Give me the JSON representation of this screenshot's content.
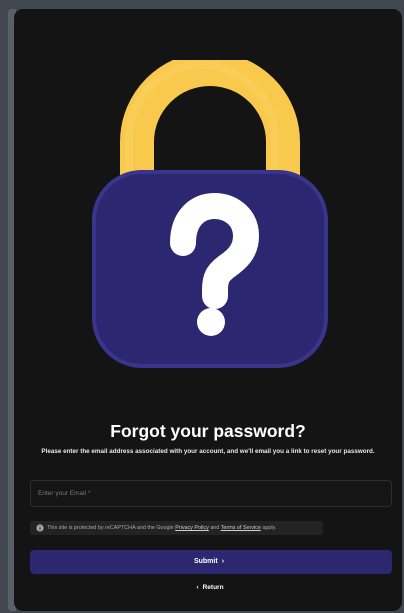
{
  "title": "Forgot your password?",
  "description": "Please enter the email address associated with your account, and we'll email you a link to reset your password.",
  "email": {
    "placeholder": "Enter your Email",
    "required_marker": "*",
    "value": ""
  },
  "recaptcha": {
    "prefix": "This site is protected by reCAPTCHA and the Google",
    "privacy_link": "Privacy Policy",
    "and": "and",
    "terms_link": "Terms of Service",
    "suffix": "apply."
  },
  "submit_label": "Submit",
  "return_label": "Return",
  "icons": {
    "illustration": "padlock-question-icon",
    "info": "info-icon",
    "submit": "chevron-right-icon",
    "return": "chevron-left-icon"
  },
  "colors": {
    "background": "#141414",
    "button": "#2b2770",
    "lock_shackle": "#f8c94c",
    "lock_body": "#2b2770",
    "text": "#ffffff"
  }
}
